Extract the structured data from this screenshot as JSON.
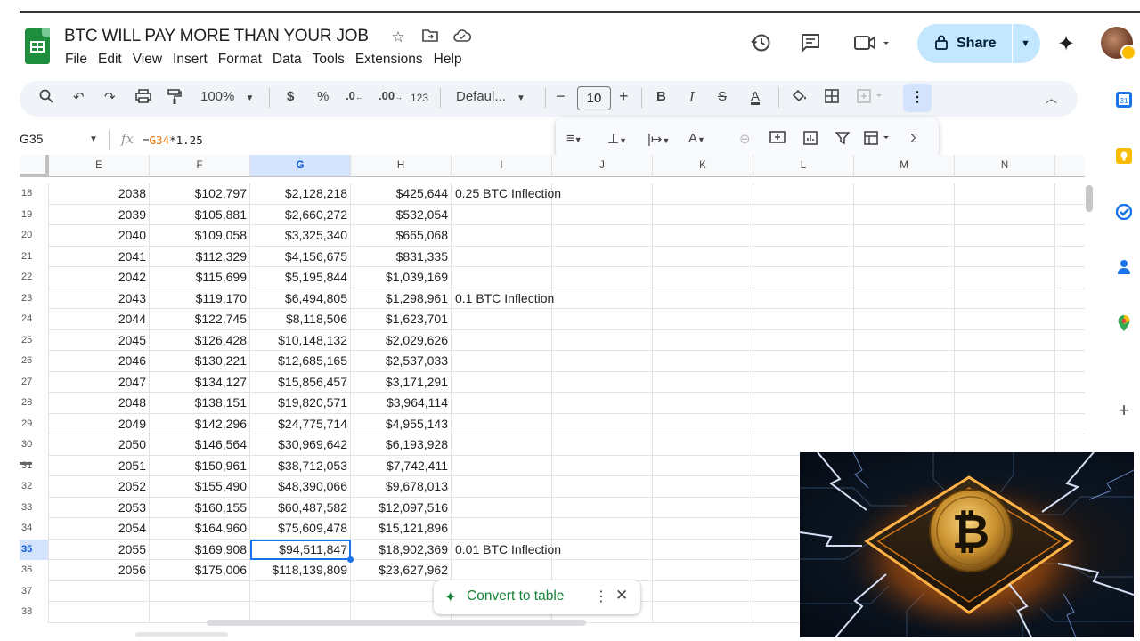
{
  "window": {
    "doc_title": "BTC WILL PAY MORE THAN YOUR JOB",
    "menu": [
      "File",
      "Edit",
      "View",
      "Insert",
      "Format",
      "Data",
      "Tools",
      "Extensions",
      "Help"
    ],
    "share_label": "Share"
  },
  "toolbar": {
    "zoom": "100%",
    "currency": "$",
    "percent": "%",
    "decrease_decimal": ".0",
    "increase_decimal": ".00",
    "number_format": "123",
    "font": "Defaul...",
    "font_size": "10",
    "bold": "B",
    "italic": "I",
    "text_color": "A"
  },
  "formula_bar": {
    "name_box": "G35",
    "fx": "fx",
    "formula_prefix": "=",
    "formula_ref": "G34",
    "formula_rest": "*1.25"
  },
  "grid": {
    "columns": [
      "E",
      "F",
      "G",
      "H",
      "I",
      "J",
      "K",
      "L",
      "M",
      "N"
    ],
    "selected_column": "G",
    "rows": [
      {
        "n": "18",
        "e": "2038",
        "f": "$102,797",
        "g": "$2,128,218",
        "h": "$425,644",
        "i": "0.25 BTC Inflection"
      },
      {
        "n": "19",
        "e": "2039",
        "f": "$105,881",
        "g": "$2,660,272",
        "h": "$532,054",
        "i": ""
      },
      {
        "n": "20",
        "e": "2040",
        "f": "$109,058",
        "g": "$3,325,340",
        "h": "$665,068",
        "i": ""
      },
      {
        "n": "21",
        "e": "2041",
        "f": "$112,329",
        "g": "$4,156,675",
        "h": "$831,335",
        "i": ""
      },
      {
        "n": "22",
        "e": "2042",
        "f": "$115,699",
        "g": "$5,195,844",
        "h": "$1,039,169",
        "i": ""
      },
      {
        "n": "23",
        "e": "2043",
        "f": "$119,170",
        "g": "$6,494,805",
        "h": "$1,298,961",
        "i": "0.1 BTC Inflection"
      },
      {
        "n": "24",
        "e": "2044",
        "f": "$122,745",
        "g": "$8,118,506",
        "h": "$1,623,701",
        "i": ""
      },
      {
        "n": "25",
        "e": "2045",
        "f": "$126,428",
        "g": "$10,148,132",
        "h": "$2,029,626",
        "i": ""
      },
      {
        "n": "26",
        "e": "2046",
        "f": "$130,221",
        "g": "$12,685,165",
        "h": "$2,537,033",
        "i": ""
      },
      {
        "n": "27",
        "e": "2047",
        "f": "$134,127",
        "g": "$15,856,457",
        "h": "$3,171,291",
        "i": ""
      },
      {
        "n": "28",
        "e": "2048",
        "f": "$138,151",
        "g": "$19,820,571",
        "h": "$3,964,114",
        "i": ""
      },
      {
        "n": "29",
        "e": "2049",
        "f": "$142,296",
        "g": "$24,775,714",
        "h": "$4,955,143",
        "i": ""
      },
      {
        "n": "30",
        "e": "2050",
        "f": "$146,564",
        "g": "$30,969,642",
        "h": "$6,193,928",
        "i": ""
      },
      {
        "n": "31",
        "e": "2051",
        "f": "$150,961",
        "g": "$38,712,053",
        "h": "$7,742,411",
        "i": ""
      },
      {
        "n": "32",
        "e": "2052",
        "f": "$155,490",
        "g": "$48,390,066",
        "h": "$9,678,013",
        "i": ""
      },
      {
        "n": "33",
        "e": "2053",
        "f": "$160,155",
        "g": "$60,487,582",
        "h": "$12,097,516",
        "i": ""
      },
      {
        "n": "34",
        "e": "2054",
        "f": "$164,960",
        "g": "$75,609,478",
        "h": "$15,121,896",
        "i": ""
      },
      {
        "n": "35",
        "e": "2055",
        "f": "$169,908",
        "g": "$94,511,847",
        "h": "$18,902,369",
        "i": "0.01 BTC Inflection"
      },
      {
        "n": "36",
        "e": "2056",
        "f": "$175,006",
        "g": "$118,139,809",
        "h": "$23,627,962",
        "i": ""
      },
      {
        "n": "37",
        "e": "",
        "f": "",
        "g": "",
        "h": "",
        "i": ""
      },
      {
        "n": "38",
        "e": "",
        "f": "",
        "g": "",
        "h": "",
        "i": ""
      }
    ],
    "active_row": "35"
  },
  "convert_chip": {
    "label": "Convert to table"
  },
  "colors": {
    "accent": "#1a73e8",
    "share_bg": "#c2e7ff",
    "sheets_green": "#1e8e3e",
    "selection_header": "#d3e3fd"
  },
  "icons": {
    "header": [
      "star-icon",
      "move-to-folder-icon",
      "cloud-status-icon",
      "version-history-icon",
      "comments-icon",
      "meet-icon",
      "lock-icon",
      "gemini-icon"
    ],
    "side_panel": [
      "calendar-icon",
      "keep-icon",
      "tasks-icon",
      "contacts-icon",
      "maps-icon",
      "add-icon"
    ]
  }
}
